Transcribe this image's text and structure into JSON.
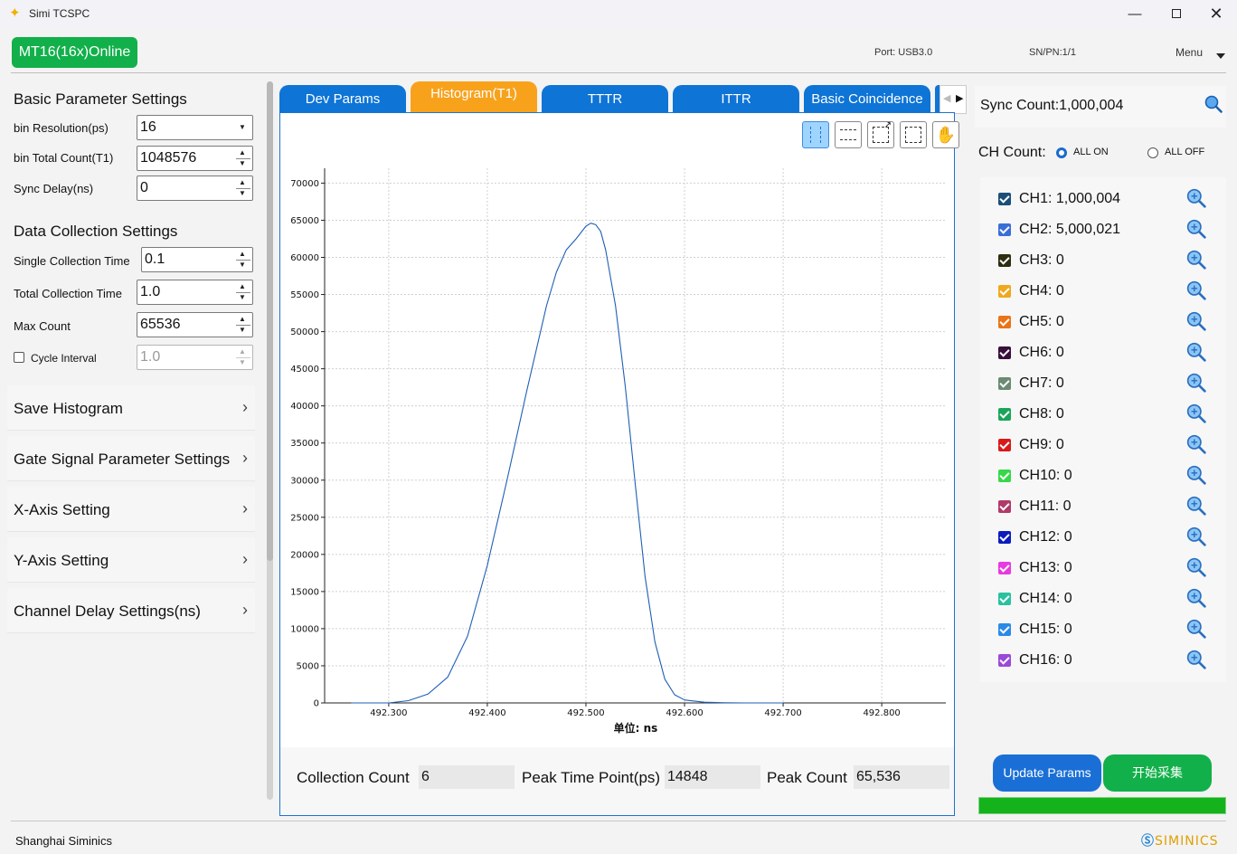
{
  "window": {
    "title": "Simi TCSPC",
    "icon": "app-logo-icon"
  },
  "header": {
    "device_status": "MT16(16x)Online",
    "port": "Port: USB3.0",
    "sn": "SN/PN:1/1",
    "menu": "Menu"
  },
  "basic_params": {
    "title": "Basic Parameter Settings",
    "bin_resolution_label": "bin Resolution(ps)",
    "bin_resolution_value": "16",
    "bin_total_label": "bin Total Count(T1)",
    "bin_total_value": "1048576",
    "sync_delay_label": "Sync Delay(ns)",
    "sync_delay_value": "0"
  },
  "data_collection": {
    "title": "Data Collection Settings",
    "single_label": "Single Collection Time",
    "single_value": "0.1",
    "total_label": "Total Collection Time",
    "total_value": "1.0",
    "max_label": "Max Count",
    "max_value": "65536",
    "cycle_label": "Cycle Interval",
    "cycle_value": "1.0",
    "cycle_checked": false
  },
  "collapsibles": [
    "Save Histogram",
    "Gate Signal Parameter Settings",
    "X-Axis Setting",
    "Y-Axis Setting",
    "Channel Delay Settings(ns)"
  ],
  "tabs": [
    "Dev Params",
    "Histogram(T1)",
    "TTTR",
    "ITTR",
    "Basic Coincidence"
  ],
  "active_tab": "Histogram(T1)",
  "toolbar": {
    "tools": [
      "vertical-select-icon",
      "horizontal-select-icon",
      "zoom-rect-icon",
      "rect-select-icon",
      "pan-hand-icon"
    ],
    "active": "vertical-select-icon"
  },
  "chart_data": {
    "type": "line",
    "xlabel": "单位: ns",
    "ylabel": "",
    "title": "",
    "xlim": [
      492.235,
      492.865
    ],
    "ylim": [
      0,
      72000
    ],
    "xticks": [
      "492.300",
      "492.400",
      "492.500",
      "492.600",
      "492.700",
      "492.800"
    ],
    "yticks": [
      "0",
      "5000",
      "10000",
      "15000",
      "20000",
      "25000",
      "30000",
      "35000",
      "40000",
      "45000",
      "50000",
      "55000",
      "60000",
      "65000",
      "70000"
    ],
    "grid": true,
    "color": "#1f5fb5",
    "series": [
      {
        "x": [
          492.262,
          492.3,
          492.32,
          492.34,
          492.36,
          492.38,
          492.4,
          492.42,
          492.44,
          492.46,
          492.47,
          492.48,
          492.49,
          492.5,
          492.505,
          492.51,
          492.515,
          492.52,
          492.53,
          492.54,
          492.55,
          492.56,
          492.57,
          492.58,
          492.59,
          492.6,
          492.62,
          492.64,
          492.66,
          492.7
        ],
        "y": [
          0,
          0,
          300,
          1200,
          3500,
          9000,
          18500,
          30000,
          42000,
          53500,
          58000,
          61000,
          62500,
          64200,
          64600,
          64400,
          63500,
          61000,
          53500,
          42500,
          29500,
          17000,
          8200,
          3200,
          1100,
          400,
          100,
          20,
          0,
          0
        ]
      }
    ]
  },
  "stats": {
    "collection_count_label": "Collection Count",
    "collection_count": "6",
    "peak_time_label": "Peak Time Point(ps)",
    "peak_time": "14848",
    "peak_count_label": "Peak Count",
    "peak_count": "65,536"
  },
  "right": {
    "sync_count_label": "Sync Count:",
    "sync_count": "1,000,004",
    "ch_count_label": "CH Count:",
    "all_on": "ALL ON",
    "all_off": "ALL OFF",
    "all_on_selected": true,
    "channels": [
      {
        "label": "CH1: 1,000,004",
        "color": "#1b4f7a"
      },
      {
        "label": "CH2: 5,000,021",
        "color": "#3a6fd6"
      },
      {
        "label": "CH3: 0",
        "color": "#2e2e10"
      },
      {
        "label": "CH4: 0",
        "color": "#f0a81c"
      },
      {
        "label": "CH5: 0",
        "color": "#ea7416"
      },
      {
        "label": "CH6: 0",
        "color": "#3a0f3c"
      },
      {
        "label": "CH7: 0",
        "color": "#6c8a74"
      },
      {
        "label": "CH8: 0",
        "color": "#1aa65a"
      },
      {
        "label": "CH9: 0",
        "color": "#d81a1a"
      },
      {
        "label": "CH10: 0",
        "color": "#36d84a"
      },
      {
        "label": "CH11: 0",
        "color": "#b03a6a"
      },
      {
        "label": "CH12: 0",
        "color": "#0a1cbe"
      },
      {
        "label": "CH13: 0",
        "color": "#e83ae0"
      },
      {
        "label": "CH14: 0",
        "color": "#28c2a0"
      },
      {
        "label": "CH15: 0",
        "color": "#2a8ae8"
      },
      {
        "label": "CH16: 0",
        "color": "#9a4ad8"
      }
    ],
    "update_btn": "Update Params",
    "start_btn": "开始采集",
    "progress": 1.0
  },
  "footer": {
    "company": "Shanghai Siminics",
    "logo": "SIMINICS"
  }
}
